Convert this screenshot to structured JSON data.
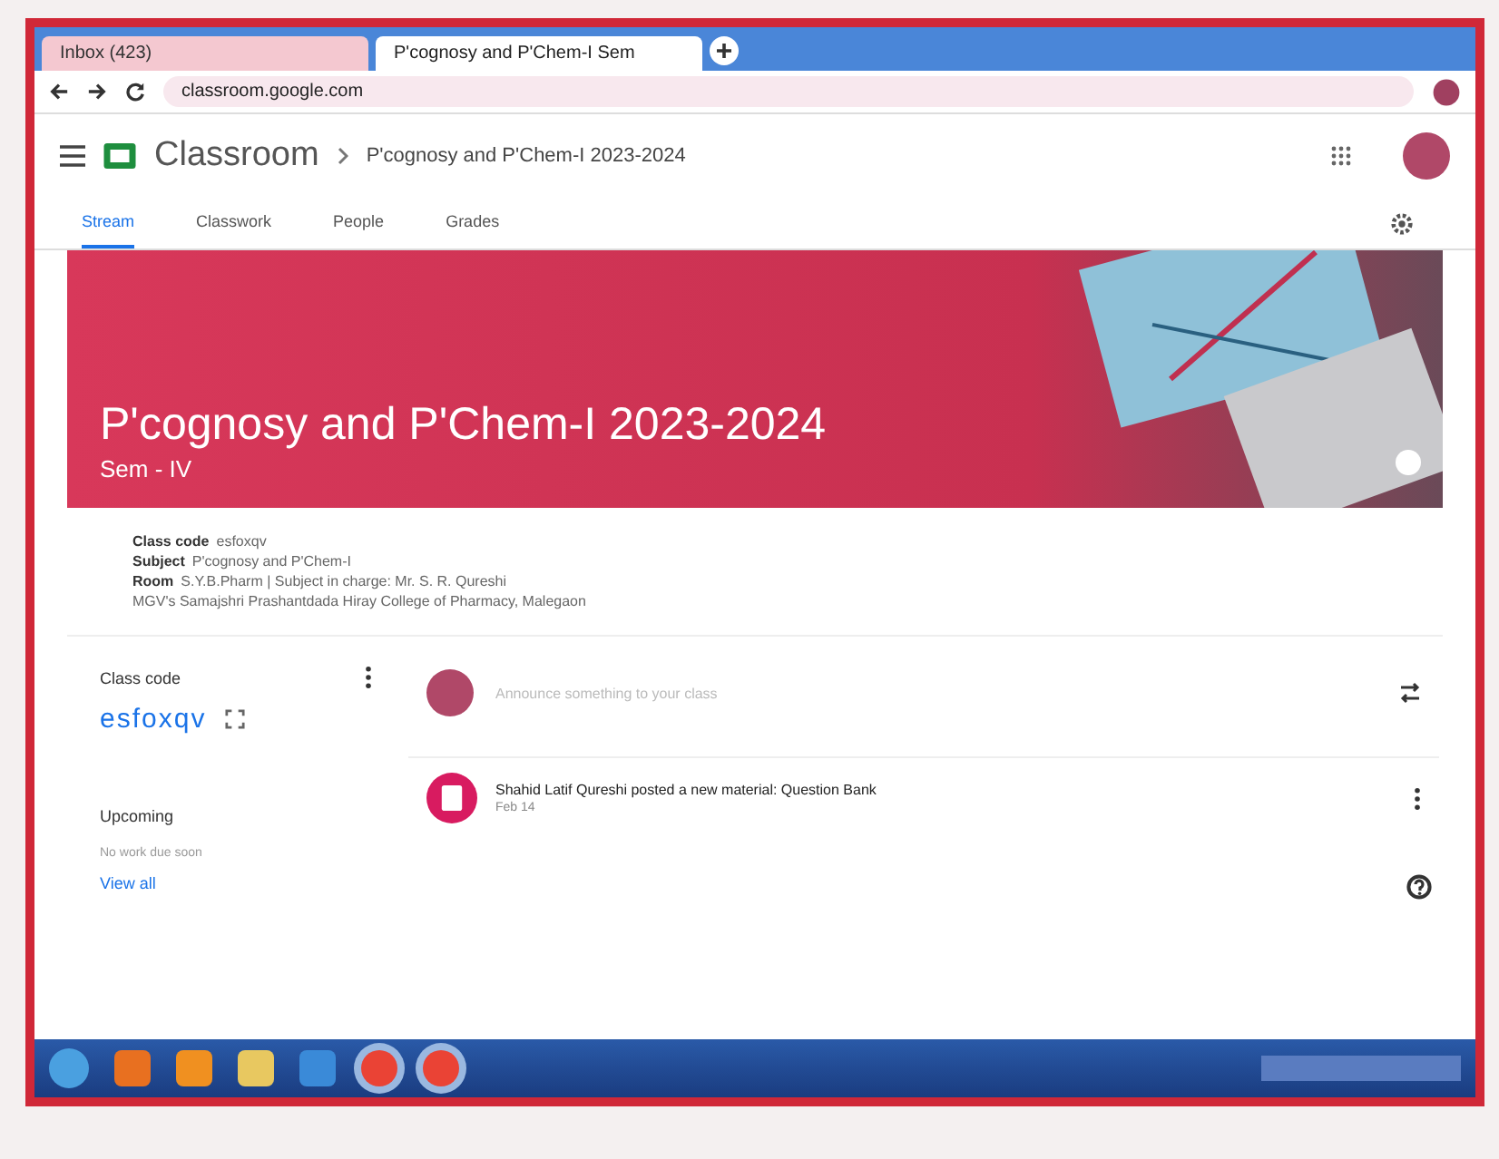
{
  "browser": {
    "tabs": [
      {
        "title": "Inbox (423)",
        "selected": false
      },
      {
        "title": "P'cognosy and P'Chem-I Sem",
        "selected": true
      }
    ],
    "url": "classroom.google.com"
  },
  "header": {
    "app": "Classroom",
    "class_title": "P'cognosy and P'Chem-I 2023-2024"
  },
  "nav_tabs": [
    {
      "label": "Stream",
      "selected": true
    },
    {
      "label": "Classwork",
      "selected": false
    },
    {
      "label": "People",
      "selected": false
    },
    {
      "label": "Grades",
      "selected": false
    }
  ],
  "banner": {
    "title": "P'cognosy and P'Chem-I 2023-2024",
    "section": "Sem - IV"
  },
  "details": [
    {
      "label": "Class code",
      "value": "esfoxqv"
    },
    {
      "label": "Subject",
      "value": "P'cognosy and P'Chem-I"
    },
    {
      "label": "Room",
      "value": "S.Y.B.Pharm | Subject in charge: Mr. S. R. Qureshi"
    },
    {
      "value": "MGV's Samajshri Prashantdada Hiray College of Pharmacy, Malegaon"
    }
  ],
  "class_code_card": {
    "title": "Class code",
    "code": "esfoxqv"
  },
  "upcoming": {
    "title": "Upcoming",
    "note": "No work due soon",
    "link": "View all"
  },
  "announce": {
    "placeholder": "Announce something to your class"
  },
  "posts": [
    {
      "text": "Shahid Latif Qureshi posted a new material: Question Bank",
      "date": "Feb 14"
    }
  ]
}
